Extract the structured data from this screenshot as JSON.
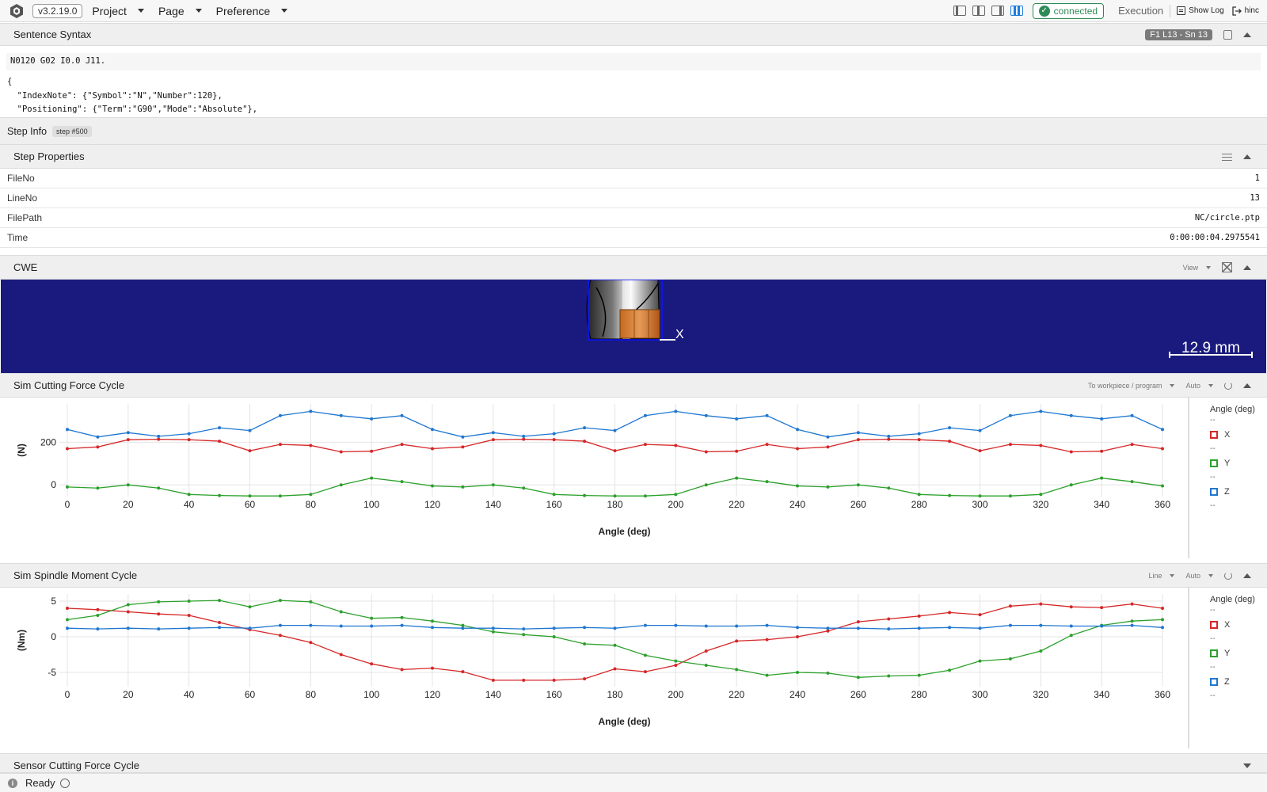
{
  "topbar": {
    "version": "v3.2.19.0",
    "menu": [
      "Project",
      "Page",
      "Preference"
    ],
    "status": "connected",
    "execution": "Execution",
    "show_log": "Show Log",
    "user": "hinc"
  },
  "sentence_syntax": {
    "title": "Sentence Syntax",
    "position_badge": "F1 L13 - Sn 13",
    "raw_line": "N0120 G02 I0.0 J11.",
    "json_lines": [
      "{",
      "  \"IndexNote\": {\"Symbol\":\"N\",\"Number\":120},",
      "  \"Positioning\": {\"Term\":\"G90\",\"Mode\":\"Absolute\"},"
    ]
  },
  "step_info": {
    "title": "Step Info",
    "step_tag": "step #500"
  },
  "step_properties": {
    "title": "Step Properties",
    "rows": [
      {
        "key": "FileNo",
        "value": "1"
      },
      {
        "key": "LineNo",
        "value": "13"
      },
      {
        "key": "FilePath",
        "value": "NC/circle.ptp"
      },
      {
        "key": "Time",
        "value": "0:00:00:04.2975541"
      }
    ]
  },
  "cwe": {
    "title": "CWE",
    "view_label": "View",
    "axis_label": "X",
    "scale_label": "12.9 mm"
  },
  "cutting_force_panel": {
    "title": "Sim Cutting Force Cycle",
    "mode_label": "To workpiece / program",
    "scale_label": "Auto"
  },
  "spindle_moment_panel": {
    "title": "Sim Spindle Moment Cycle",
    "mode_label": "Line",
    "scale_label": "Auto"
  },
  "sensor_panel": {
    "title": "Sensor Cutting Force Cycle"
  },
  "statusbar": {
    "status": "Ready"
  },
  "colors": {
    "x": "#d62728",
    "y": "#2ca02c",
    "z": "#1f77d0",
    "cwe_bg": "#1a1a7e",
    "accent_connected": "#2e8b57"
  },
  "chart_data": [
    {
      "type": "line",
      "title": "",
      "xlabel": "Angle (deg)",
      "ylabel": "(N)",
      "xlim": [
        0,
        360
      ],
      "ylim": [
        -55,
        380
      ],
      "xticks": [
        0,
        20,
        40,
        60,
        80,
        100,
        120,
        140,
        160,
        180,
        200,
        220,
        240,
        260,
        280,
        300,
        320,
        340,
        360
      ],
      "yticks": [
        0,
        200
      ],
      "legend": {
        "title": "Angle (deg)",
        "placeholder": "--",
        "entries": [
          "X",
          "Y",
          "Z"
        ],
        "position": "right"
      },
      "x": [
        0,
        10,
        20,
        30,
        40,
        50,
        60,
        70,
        80,
        90,
        100,
        110,
        120,
        130,
        140,
        150,
        160,
        170,
        180,
        190,
        200,
        210,
        220,
        230,
        240,
        250,
        260,
        270,
        280,
        290,
        300,
        310,
        320,
        330,
        340,
        350,
        360
      ],
      "series": [
        {
          "name": "X",
          "values": [
            170,
            178,
            212,
            214,
            212,
            205,
            160,
            190,
            185,
            155,
            158,
            190,
            170,
            178,
            212,
            214,
            212,
            205,
            160,
            190,
            185,
            155,
            158,
            190,
            170,
            178,
            212,
            214,
            212,
            205,
            160,
            190,
            185,
            155,
            158,
            190,
            170
          ]
        },
        {
          "name": "Y",
          "values": [
            -10,
            -15,
            0,
            -15,
            -45,
            -50,
            -52,
            -52,
            -45,
            0,
            32,
            15,
            -5,
            -10,
            0,
            -15,
            -45,
            -50,
            -52,
            -52,
            -45,
            0,
            32,
            15,
            -5,
            -10,
            0,
            -15,
            -45,
            -50,
            -52,
            -52,
            -45,
            0,
            32,
            15,
            -5
          ]
        },
        {
          "name": "Z",
          "values": [
            260,
            225,
            245,
            228,
            240,
            268,
            255,
            325,
            345,
            325,
            310,
            325,
            260,
            225,
            245,
            228,
            240,
            268,
            255,
            325,
            345,
            325,
            310,
            325,
            260,
            225,
            245,
            228,
            240,
            268,
            255,
            325,
            345,
            325,
            310,
            325,
            260
          ]
        }
      ]
    },
    {
      "type": "line",
      "title": "",
      "xlabel": "Angle (deg)",
      "ylabel": "(Nm)",
      "xlim": [
        0,
        360
      ],
      "ylim": [
        -7,
        6
      ],
      "xticks": [
        0,
        20,
        40,
        60,
        80,
        100,
        120,
        140,
        160,
        180,
        200,
        220,
        240,
        260,
        280,
        300,
        320,
        340,
        360
      ],
      "yticks": [
        -5,
        0,
        5
      ],
      "legend": {
        "title": "Angle (deg)",
        "placeholder": "--",
        "entries": [
          "X",
          "Y",
          "Z"
        ],
        "position": "right"
      },
      "x": [
        0,
        10,
        20,
        30,
        40,
        50,
        60,
        70,
        80,
        90,
        100,
        110,
        120,
        130,
        140,
        150,
        160,
        170,
        180,
        190,
        200,
        210,
        220,
        230,
        240,
        250,
        260,
        270,
        280,
        290,
        300,
        310,
        320,
        330,
        340,
        350,
        360
      ],
      "series": [
        {
          "name": "X",
          "values": [
            4.0,
            3.8,
            3.5,
            3.2,
            3.0,
            2.0,
            1.0,
            0.2,
            -0.8,
            -2.5,
            -3.8,
            -4.6,
            -4.4,
            -4.9,
            -6.1,
            -6.1,
            -6.1,
            -5.9,
            -4.5,
            -4.9,
            -4.0,
            -2.0,
            -0.6,
            -0.4,
            0.0,
            0.8,
            2.1,
            2.5,
            2.9,
            3.4,
            3.1,
            4.3,
            4.6,
            4.2,
            4.1,
            4.6,
            4.0
          ]
        },
        {
          "name": "Y",
          "values": [
            2.4,
            3.0,
            4.5,
            4.9,
            5.0,
            5.1,
            4.2,
            5.1,
            4.9,
            3.5,
            2.6,
            2.7,
            2.2,
            1.6,
            0.7,
            0.3,
            0.0,
            -1.0,
            -1.2,
            -2.6,
            -3.4,
            -4.0,
            -4.6,
            -5.4,
            -5.0,
            -5.1,
            -5.7,
            -5.5,
            -5.4,
            -4.7,
            -3.4,
            -3.1,
            -2.0,
            0.2,
            1.6,
            2.2,
            2.4
          ]
        },
        {
          "name": "Z",
          "values": [
            1.2,
            1.1,
            1.2,
            1.1,
            1.2,
            1.3,
            1.2,
            1.6,
            1.6,
            1.5,
            1.5,
            1.6,
            1.3,
            1.2,
            1.2,
            1.1,
            1.2,
            1.3,
            1.2,
            1.6,
            1.6,
            1.5,
            1.5,
            1.6,
            1.3,
            1.2,
            1.2,
            1.1,
            1.2,
            1.3,
            1.2,
            1.6,
            1.6,
            1.5,
            1.5,
            1.6,
            1.3
          ]
        }
      ]
    }
  ]
}
